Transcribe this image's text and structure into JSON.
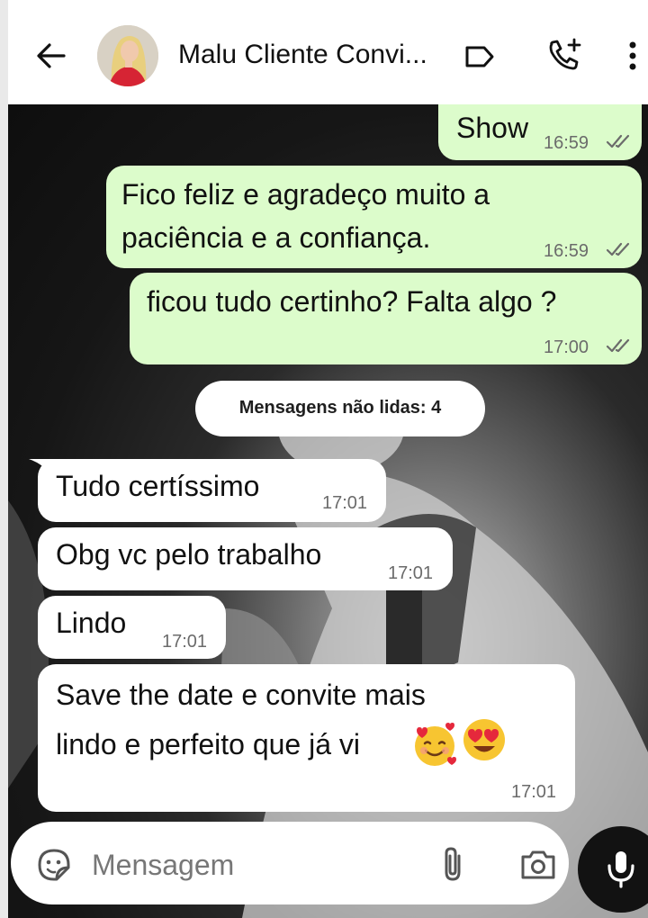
{
  "header": {
    "contact_name": "Malu Cliente Convi...",
    "icons": [
      "back-arrow-icon",
      "avatar",
      "label-icon",
      "add-call-icon",
      "more-vert-icon"
    ]
  },
  "messages": [
    {
      "direction": "outgoing",
      "lines": [
        "Show"
      ],
      "time": "16:59",
      "status": "read-double-tick"
    },
    {
      "direction": "outgoing",
      "lines": [
        "Fico feliz e agradeço muito a",
        "paciência e a confiança."
      ],
      "time": "16:59",
      "status": "read-double-tick"
    },
    {
      "direction": "outgoing",
      "lines": [
        "ficou tudo certinho? Falta algo ?"
      ],
      "time": "17:00",
      "status": "read-double-tick"
    },
    {
      "direction": "incoming",
      "lines": [
        "Tudo certíssimo"
      ],
      "time": "17:01"
    },
    {
      "direction": "incoming",
      "lines": [
        "Obg vc pelo trabalho"
      ],
      "time": "17:01"
    },
    {
      "direction": "incoming",
      "lines": [
        "Lindo"
      ],
      "time": "17:01"
    },
    {
      "direction": "incoming",
      "lines": [
        "Save the date e convite mais",
        "lindo e perfeito que já vi"
      ],
      "emojis": [
        "smiling-face-with-hearts-icon",
        "heart-eyes-icon"
      ],
      "time": "17:01"
    }
  ],
  "unread_divider": "Mensagens não lidas: 4",
  "composer": {
    "placeholder": "Mensagem",
    "icons": [
      "sticker-icon",
      "attach-icon",
      "camera-icon",
      "mic-icon"
    ]
  },
  "colors": {
    "outgoing_bubble": "#dcfccb",
    "incoming_bubble": "#ffffff",
    "time_text": "#6b6b6b",
    "header_bg": "#ffffff",
    "mic_button": "#121212"
  }
}
